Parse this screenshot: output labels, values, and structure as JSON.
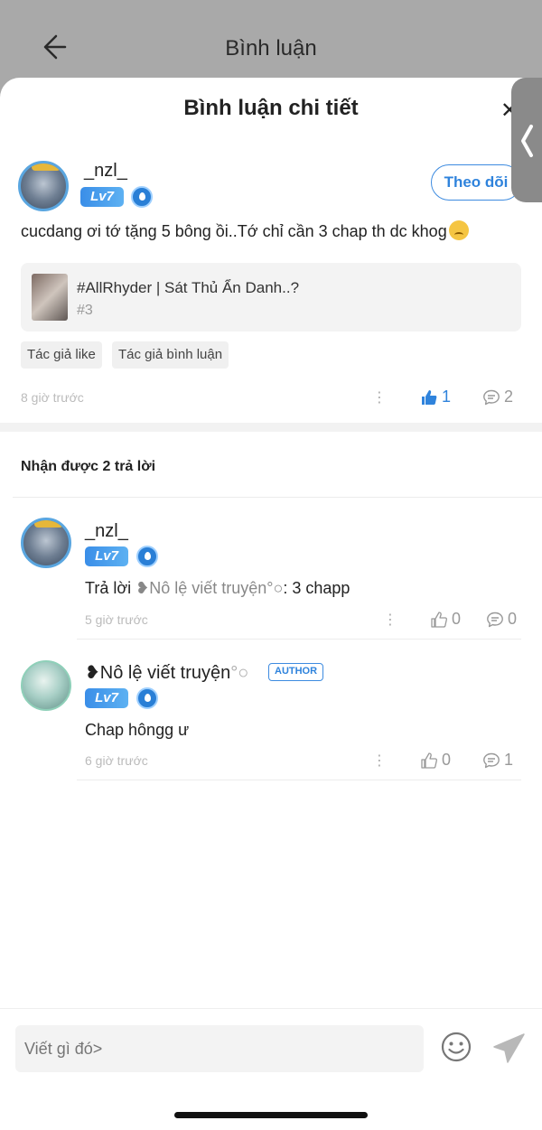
{
  "backdrop": {
    "title": "Bình luận"
  },
  "sheet": {
    "title": "Bình luận chi tiết"
  },
  "main_comment": {
    "username": "_nzl_",
    "level": "Lv7",
    "follow_label": "Theo dõi",
    "text": "cucdang ơi tớ tặng 5 bông ồi..Tớ chỉ cần 3 chap th dc khog",
    "emoji": "pleading-face",
    "story": {
      "title": "#AllRhyder | Sát Thủ Ẩn Danh..?",
      "chapter": "#3"
    },
    "tags": [
      "Tác giả like",
      "Tác giả bình luận"
    ],
    "time": "8 giờ trước",
    "more": "⋮",
    "likes": "1",
    "replies": "2"
  },
  "replies_header": "Nhận được 2 trả lời",
  "replies": [
    {
      "username": "_nzl_",
      "level": "Lv7",
      "text_prefix": "Trả lời ",
      "mention": "❥Nô lệ viết truyện",
      "mention_suffix": "°○",
      "text_suffix": ": 3 chapp",
      "time": "5 giờ trước",
      "more": "⋮",
      "likes": "0",
      "replies": "0"
    },
    {
      "username": "❥Nô lệ viết truyện",
      "username_suffix": "°○",
      "level": "Lv7",
      "author_badge": "AUTHOR",
      "text": "Chap hôngg ư",
      "time": "6 giờ trước",
      "more": "⋮",
      "likes": "0",
      "replies": "1"
    }
  ],
  "input": {
    "placeholder": "Viết gì đó>"
  },
  "colors": {
    "accent": "#2f83dc",
    "like_active": "#2f83dc",
    "muted": "#bbbbbb"
  },
  "icons": [
    "back-arrow-icon",
    "close-icon",
    "chevron-left-icon",
    "water-drop-icon",
    "thumbs-up-icon",
    "comment-icon",
    "more-icon",
    "smiley-icon",
    "send-icon"
  ]
}
